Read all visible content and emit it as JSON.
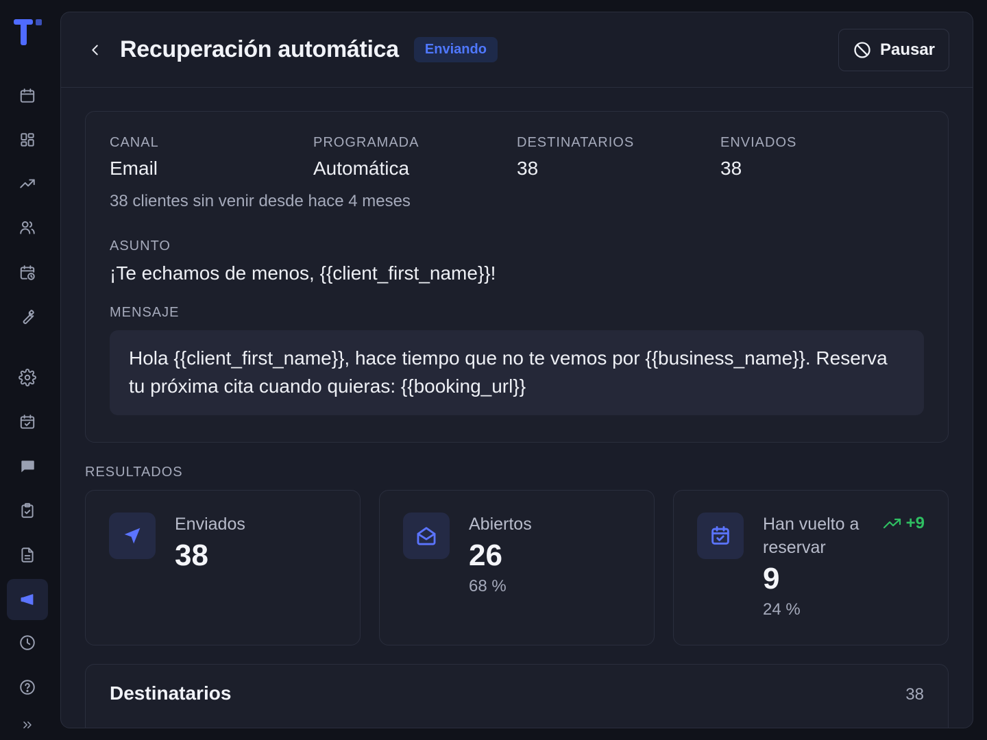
{
  "sidebar": {
    "items": [
      {
        "name": "calendar"
      },
      {
        "name": "dashboard"
      },
      {
        "name": "analytics"
      },
      {
        "name": "clients"
      },
      {
        "name": "schedule"
      },
      {
        "name": "tools"
      },
      {
        "name": "settings"
      },
      {
        "name": "bookings"
      },
      {
        "name": "messages"
      },
      {
        "name": "tasks"
      },
      {
        "name": "documents"
      },
      {
        "name": "campaigns",
        "active": true
      },
      {
        "name": "history"
      },
      {
        "name": "help"
      },
      {
        "name": "expand"
      }
    ]
  },
  "header": {
    "title": "Recuperación automática",
    "status_badge": "Enviando",
    "pause_label": "Pausar"
  },
  "info": {
    "channel_label": "CANAL",
    "channel_value": "Email",
    "scheduled_label": "PROGRAMADA",
    "scheduled_value": "Automática",
    "recipients_label": "DESTINATARIOS",
    "recipients_value": "38",
    "sent_label": "ENVIADOS",
    "sent_value": "38",
    "audience_description": "38 clientes sin venir desde hace 4 meses",
    "subject_label": "ASUNTO",
    "subject_value": "¡Te echamos de menos, {{client_first_name}}!",
    "message_label": "MENSAJE",
    "message_value": "Hola {{client_first_name}}, hace tiempo que no te vemos por {{business_name}}. Reserva tu próxima cita cuando quieras: {{booking_url}}"
  },
  "results": {
    "label": "RESULTADOS",
    "sent": {
      "title": "Enviados",
      "value": "38"
    },
    "opened": {
      "title": "Abiertos",
      "value": "26",
      "percent": "68 %"
    },
    "rebooked": {
      "title": "Han vuelto a reservar",
      "value": "9",
      "percent": "24 %",
      "trend": "+9"
    }
  },
  "recipients": {
    "title": "Destinatarios",
    "count": "38"
  },
  "colors": {
    "accent": "#5b74ff",
    "badge_text": "#4f78ff",
    "trend_green": "#2fbf62",
    "panel_bg": "#1a1d29",
    "page_bg": "#10121a"
  }
}
